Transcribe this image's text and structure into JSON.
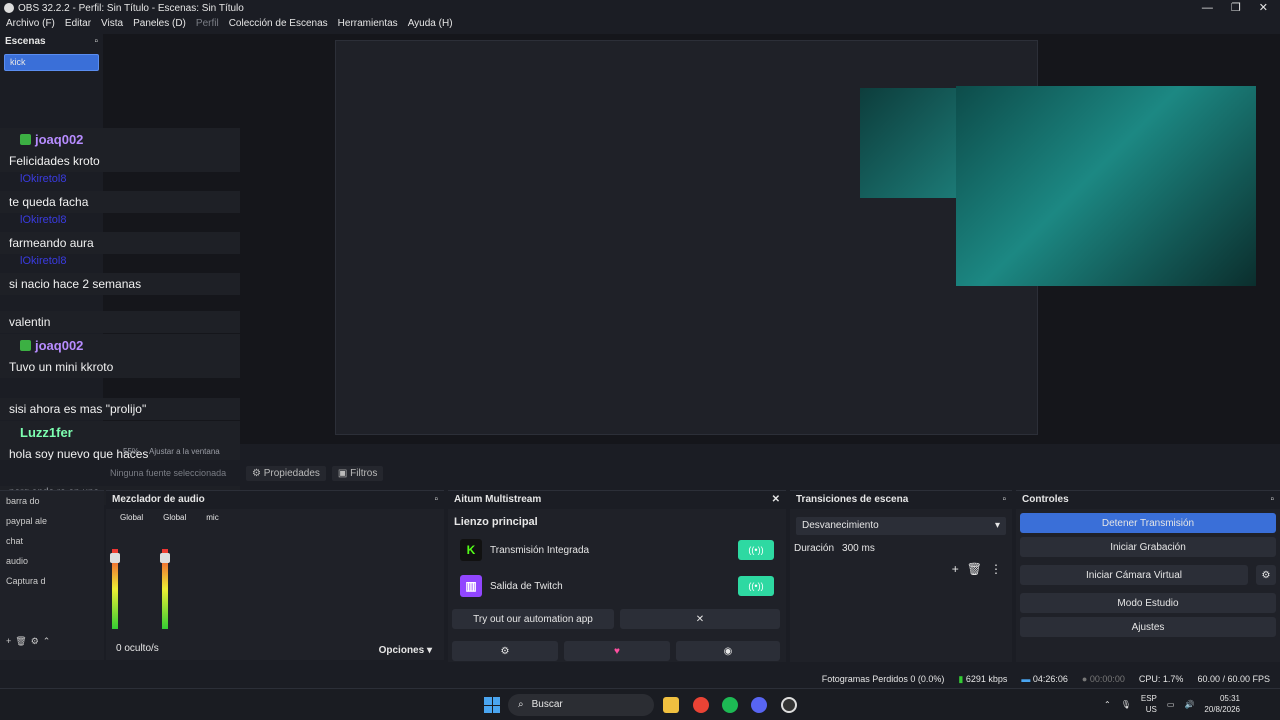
{
  "window": {
    "title": "OBS 32.2.2 - Perfil: Sin Título - Escenas: Sin Título",
    "min": "—",
    "max": "❐",
    "close": "✕"
  },
  "menu": {
    "archivo": "Archivo (F)",
    "editar": "Editar",
    "vista": "Vista",
    "paneles": "Paneles (D)",
    "perfil": "Perfil",
    "coleccion": "Colección de Escenas",
    "herramientas": "Herramientas",
    "ayuda": "Ayuda (H)"
  },
  "scenes": {
    "title": "Escenas",
    "items": [
      "kick"
    ]
  },
  "chat": {
    "m1_user": "joaq002",
    "m1_text": "Felicidades kroto",
    "m2_user": "lOkiretol8",
    "m2_text": "te queda facha",
    "m3_user": "lOkiretol8",
    "m3_text": "farmeando aura",
    "m4_user": "lOkiretol8",
    "m4_text": "si nacio hace 2 semanas",
    "m5_text": "valentin",
    "m6_user": "joaq002",
    "m6_text": "Tuvo un mini kkroto",
    "m7_text": "sisi ahora es mas \"prolijo\"",
    "m8_user": "Luzz1fer",
    "m8_text": "hola soy nuevo que haces",
    "m9_text": "porq ando re en una"
  },
  "preview_toolbar": {
    "zoom": "55%",
    "fit": "Ajustar a la ventana"
  },
  "props": {
    "no_source": "Ninguna fuente seleccionada",
    "propiedades": "Propiedades",
    "filtros": "Filtros"
  },
  "sources": {
    "items": [
      "barra do",
      "paypal ale",
      "chat",
      "audio",
      "Captura d"
    ],
    "hidden": "0 oculto/s"
  },
  "mixer": {
    "title": "Mezclador de audio",
    "ch1": "Global",
    "ch2": "Global",
    "ch3": "mic",
    "opciones": "Opciones"
  },
  "multistream": {
    "title": "Aitum Multistream",
    "section": "Lienzo principal",
    "out1": "Transmisión Integrada",
    "out2": "Salida de Twitch",
    "try_btn": "Try out our automation app"
  },
  "transitions": {
    "title": "Transiciones de escena",
    "selected": "Desvanecimiento",
    "dur_label": "Duración",
    "dur_value": "300 ms"
  },
  "controls": {
    "title": "Controles",
    "stop_stream": "Detener Transmisión",
    "start_rec": "Iniciar Grabación",
    "virtual_cam": "Iniciar Cámara Virtual",
    "studio": "Modo Estudio",
    "settings": "Ajustes"
  },
  "status": {
    "dropped": "Fotogramas Perdidos 0 (0.0%)",
    "kbps": "6291 kbps",
    "stream_time": "04:26:06",
    "rec_time": "00:00:00",
    "cpu": "CPU: 1.7%",
    "fps": "60.00 / 60.00 FPS"
  },
  "taskbar": {
    "search": "Buscar",
    "lang1": "ESP",
    "lang2": "US",
    "time": "05:31",
    "date": "20/8/2026"
  }
}
